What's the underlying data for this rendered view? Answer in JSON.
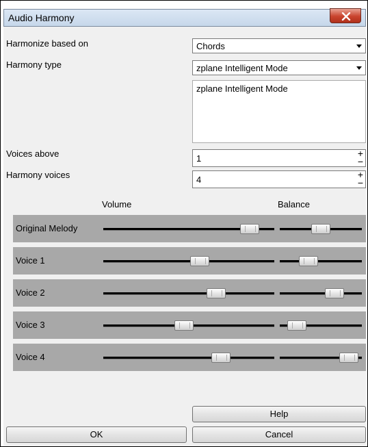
{
  "window": {
    "title": "Audio Harmony",
    "close_glyph": "✕"
  },
  "form": {
    "harmonize_label": "Harmonize based on",
    "harmonize_value": "Chords",
    "harmony_type_label": "Harmony type",
    "harmony_type_value": "zplane Intelligent Mode",
    "description": "zplane Intelligent Mode",
    "voices_above_label": "Voices above",
    "voices_above_value": "1",
    "harmony_voices_label": "Harmony voices",
    "harmony_voices_value": "4",
    "spin_plus": "+",
    "spin_minus": "−"
  },
  "mixer": {
    "volume_header": "Volume",
    "balance_header": "Balance",
    "rows": [
      {
        "label": "Original Melody",
        "volume": 0.9,
        "balance": 0.5
      },
      {
        "label": "Voice 1",
        "volume": 0.57,
        "balance": 0.3
      },
      {
        "label": "Voice 2",
        "volume": 0.68,
        "balance": 0.72
      },
      {
        "label": "Voice 3",
        "volume": 0.47,
        "balance": 0.12
      },
      {
        "label": "Voice 4",
        "volume": 0.71,
        "balance": 0.95
      }
    ]
  },
  "buttons": {
    "help": "Help",
    "ok": "OK",
    "cancel": "Cancel"
  },
  "colors": {
    "row_bg": "#a8a8a8",
    "client_bg": "#f0f0f0",
    "close_red": "#c9432d"
  }
}
